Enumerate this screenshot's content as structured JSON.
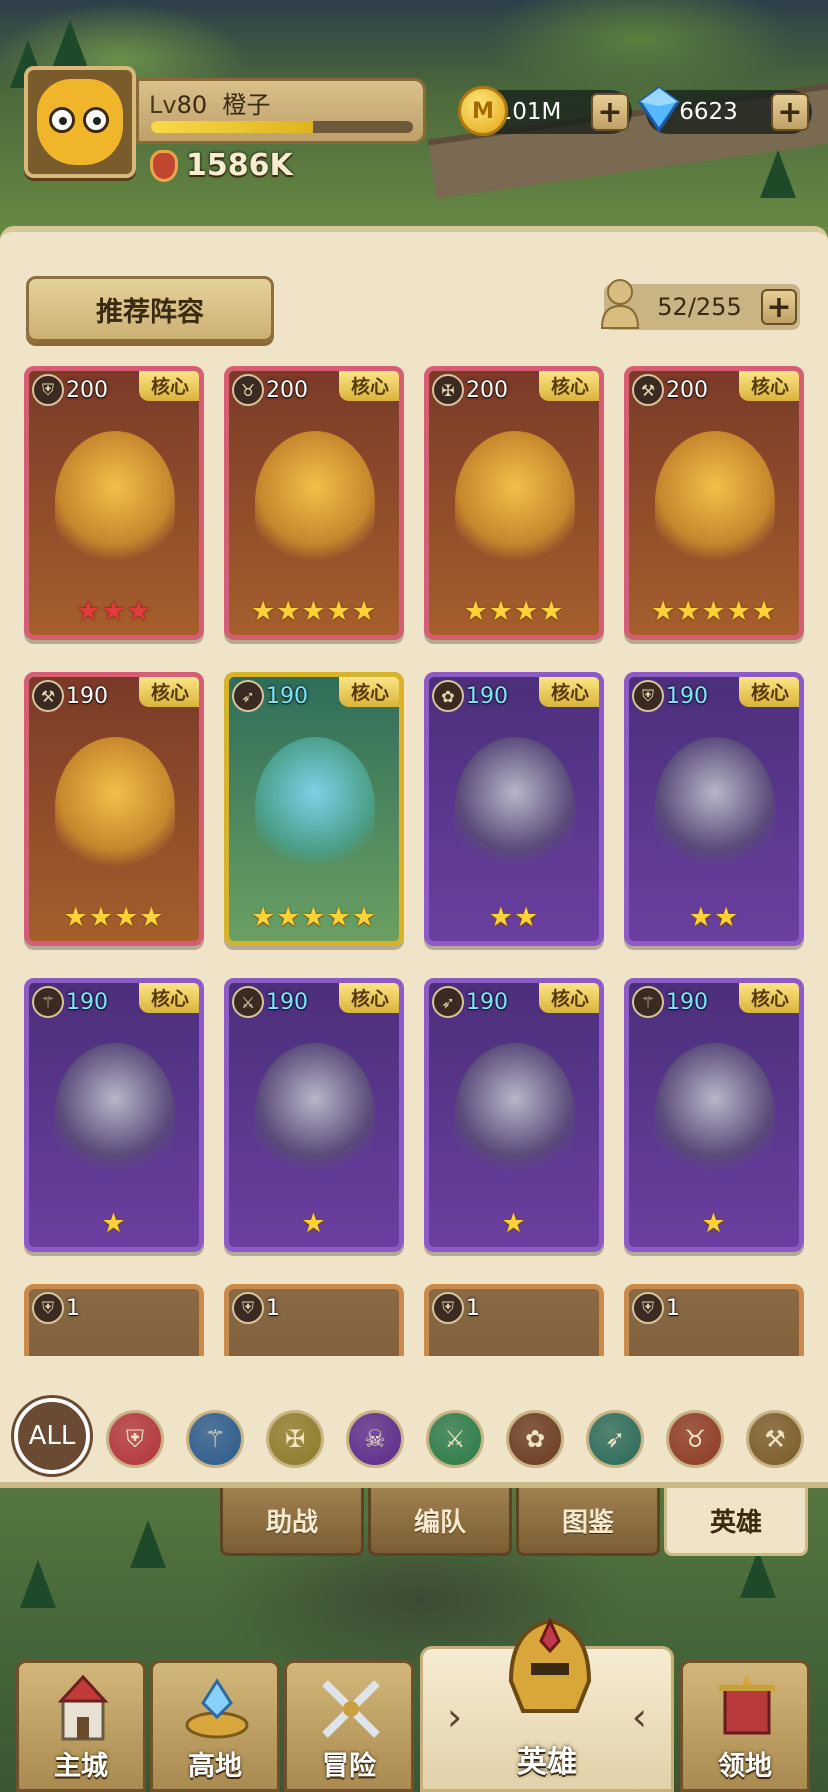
{
  "player": {
    "level_prefix": "Lv",
    "level": "80",
    "name": "橙子",
    "xp_fraction": 0.62,
    "power": "1586K"
  },
  "currencies": {
    "coins": "101M",
    "coin_symbol": "M",
    "gems": "6623"
  },
  "panel": {
    "recommend_button": "推荐阵容",
    "capacity": "52/255"
  },
  "core_tag": "核心",
  "heroes": [
    {
      "level": "200",
      "class": "shield-icon",
      "stars": 3,
      "star_color": "red",
      "frame": "pink"
    },
    {
      "level": "200",
      "class": "ox-skull-icon",
      "stars": 5,
      "star_color": "gold",
      "frame": "pink"
    },
    {
      "level": "200",
      "class": "winged-emblem-icon",
      "stars": 4,
      "star_color": "gold",
      "frame": "pink"
    },
    {
      "level": "200",
      "class": "hammer-icon",
      "stars": 5,
      "star_color": "gold",
      "frame": "pink"
    },
    {
      "level": "190",
      "class": "hammer-icon",
      "stars": 4,
      "star_color": "gold",
      "frame": "pink"
    },
    {
      "level": "190",
      "class": "bow-icon",
      "stars": 5,
      "star_color": "gold",
      "frame": "gold"
    },
    {
      "level": "190",
      "class": "paw-icon",
      "stars": 2,
      "star_color": "gold",
      "frame": "purple"
    },
    {
      "level": "190",
      "class": "shield-icon",
      "stars": 2,
      "star_color": "gold",
      "frame": "purple"
    },
    {
      "level": "190",
      "class": "staff-icon",
      "stars": 1,
      "star_color": "gold",
      "frame": "purple"
    },
    {
      "level": "190",
      "class": "crossed-daggers-icon",
      "stars": 1,
      "star_color": "gold",
      "frame": "purple"
    },
    {
      "level": "190",
      "class": "bow-icon",
      "stars": 1,
      "star_color": "gold",
      "frame": "purple"
    },
    {
      "level": "190",
      "class": "staff-icon",
      "stars": 1,
      "star_color": "gold",
      "frame": "purple"
    },
    {
      "level": "1",
      "class": "shield-icon",
      "stars": 0,
      "star_color": "gold",
      "frame": "empty"
    },
    {
      "level": "1",
      "class": "shield-icon",
      "stars": 0,
      "star_color": "gold",
      "frame": "empty"
    },
    {
      "level": "1",
      "class": "shield-icon",
      "stars": 0,
      "star_color": "gold",
      "frame": "empty"
    },
    {
      "level": "1",
      "class": "shield-icon",
      "stars": 0,
      "star_color": "gold",
      "frame": "empty"
    }
  ],
  "filters": {
    "all_label": "ALL",
    "items": [
      {
        "name": "shield-icon",
        "color": "#b0343c"
      },
      {
        "name": "staff-icon",
        "color": "#2a5a8c"
      },
      {
        "name": "winged-emblem-icon",
        "color": "#8c7a2a"
      },
      {
        "name": "skull-icon",
        "color": "#5a2a8c"
      },
      {
        "name": "crossed-daggers-icon",
        "color": "#2a7a4a"
      },
      {
        "name": "paw-icon",
        "color": "#6a3a22"
      },
      {
        "name": "bow-icon",
        "color": "#2a6a5a"
      },
      {
        "name": "ox-skull-icon",
        "color": "#8c3a22"
      },
      {
        "name": "hammer-icon",
        "color": "#7a5a2a"
      }
    ]
  },
  "subtabs": [
    "助战",
    "编队",
    "图鉴",
    "英雄"
  ],
  "active_subtab": 3,
  "nav": {
    "items": [
      "主城",
      "高地",
      "冒险",
      "英雄",
      "领地"
    ],
    "active": 3
  }
}
